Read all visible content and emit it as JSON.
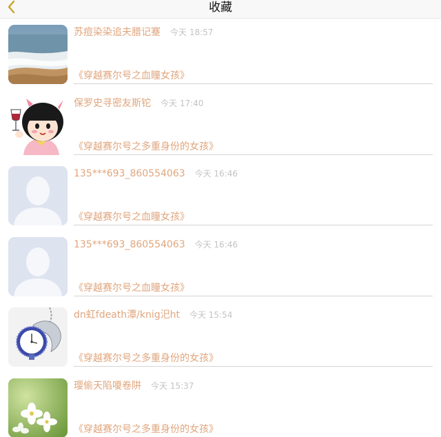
{
  "nav": {
    "title": "收藏",
    "back_icon": "chevron-left-icon",
    "accent_color": "#c9a227"
  },
  "favorites": [
    {
      "username": "苏痘染染追夫腊记蹇",
      "time": "今天 18:57",
      "book": "《穿越赛尔号之血瞳女孩》",
      "avatar": "beach-photo"
    },
    {
      "username": "保罗史寻密友斯铊",
      "time": "今天 17:40",
      "book": "《穿越赛尔号之多重身份的女孩》",
      "avatar": "cartoon-girl-with-wine"
    },
    {
      "username": "135***693_860554063",
      "time": "今天 16:46",
      "book": "《穿越赛尔号之血瞳女孩》",
      "avatar": "default-user-silhouette"
    },
    {
      "username": "135***693_860554063",
      "time": "今天 16:46",
      "book": "《穿越赛尔号之血瞳女孩》",
      "avatar": "default-user-silhouette"
    },
    {
      "username": "dn虹fdeath潭/knig汜ht",
      "time": "今天 15:54",
      "book": "《穿越赛尔号之多重身份的女孩》",
      "avatar": "dolphin-watch-photo"
    },
    {
      "username": "璎偷天陷嗄卷阱",
      "time": "今天 15:37",
      "book": "《穿越赛尔号之多重身份的女孩》",
      "avatar": "white-flowers-photo"
    }
  ],
  "colors": {
    "name_text": "#e0a57c",
    "time_text": "#c3c3c3",
    "divider": "#d4d4d4"
  }
}
